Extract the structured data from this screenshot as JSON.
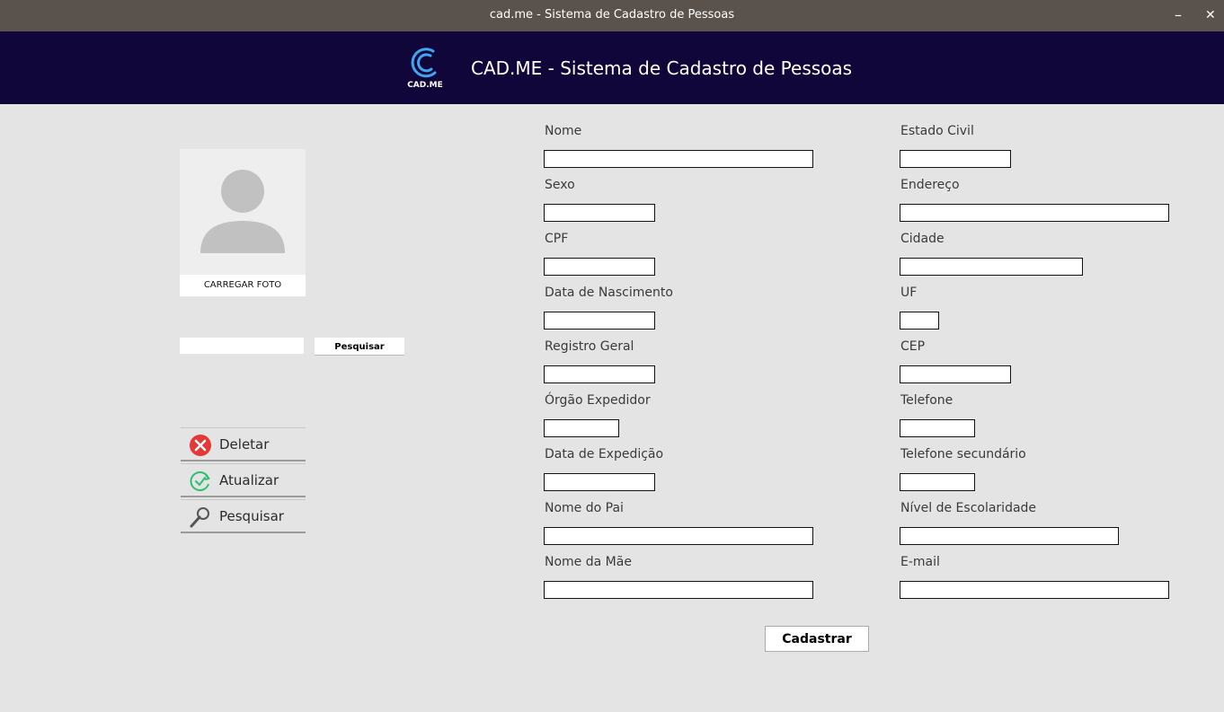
{
  "window": {
    "title": "cad.me - Sistema de Cadastro de Pessoas",
    "minimize": "–",
    "close": "✕"
  },
  "header": {
    "logo_text": "CAD.ME",
    "title": "CAD.ME - Sistema de Cadastro de Pessoas",
    "logo_color": "#3fa7f0",
    "bg_color": "#10063a"
  },
  "photo": {
    "label": "CARREGAR FOTO"
  },
  "search": {
    "value": "",
    "button": "Pesquisar"
  },
  "actions": [
    {
      "label": "Deletar",
      "icon": "delete-icon"
    },
    {
      "label": "Atualizar",
      "icon": "refresh-icon"
    },
    {
      "label": "Pesquisar",
      "icon": "search-icon"
    }
  ],
  "form": {
    "left": [
      {
        "label": "Nome",
        "value": ""
      },
      {
        "label": "Sexo",
        "value": ""
      },
      {
        "label": "CPF",
        "value": ""
      },
      {
        "label": "Data de Nascimento",
        "value": ""
      },
      {
        "label": "Registro Geral",
        "value": ""
      },
      {
        "label": "Órgão Expedidor",
        "value": ""
      },
      {
        "label": "Data de Expedição",
        "value": ""
      },
      {
        "label": "Nome do Pai",
        "value": ""
      },
      {
        "label": "Nome da Mãe",
        "value": ""
      }
    ],
    "right": [
      {
        "label": "Estado Civil",
        "value": ""
      },
      {
        "label": "Endereço",
        "value": ""
      },
      {
        "label": "Cidade",
        "value": ""
      },
      {
        "label": "UF",
        "value": ""
      },
      {
        "label": "CEP",
        "value": ""
      },
      {
        "label": "Telefone",
        "value": ""
      },
      {
        "label": "Telefone secundário",
        "value": ""
      },
      {
        "label": "Nível de Escolaridade",
        "value": ""
      },
      {
        "label": "E-mail",
        "value": ""
      }
    ],
    "submit": "Cadastrar"
  }
}
